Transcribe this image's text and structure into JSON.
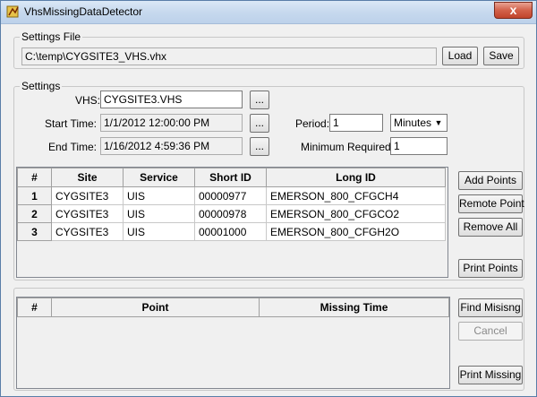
{
  "window": {
    "title": "VhsMissingDataDetector",
    "close_label": "x"
  },
  "settings_file": {
    "legend": "Settings File",
    "path": "C:\\temp\\CYGSITE3_VHS.vhx",
    "load_label": "Load",
    "save_label": "Save"
  },
  "settings": {
    "legend": "Settings",
    "vhs_label": "VHS:",
    "vhs_value": "CYGSITE3.VHS",
    "start_label": "Start Time:",
    "start_value": "1/1/2012 12:00:00 PM",
    "end_label": "End Time:",
    "end_value": "1/16/2012 4:59:36 PM",
    "browse_label": "...",
    "period_label": "Period:",
    "period_value": "1",
    "period_unit": "Minutes",
    "min_required_label": "Minimum Required:",
    "min_required_value": "1"
  },
  "points_grid": {
    "columns": [
      "#",
      "Site",
      "Service",
      "Short ID",
      "Long ID"
    ],
    "rows": [
      [
        "1",
        "CYGSITE3",
        "UIS",
        "00000977",
        "EMERSON_800_CFGCH4"
      ],
      [
        "2",
        "CYGSITE3",
        "UIS",
        "00000978",
        "EMERSON_800_CFGCO2"
      ],
      [
        "3",
        "CYGSITE3",
        "UIS",
        "00001000",
        "EMERSON_800_CFGH2O"
      ]
    ]
  },
  "points_buttons": {
    "add": "Add Points",
    "remote": "Remote Point",
    "remove_all": "Remove All",
    "print": "Print Points"
  },
  "missing_grid": {
    "columns": [
      "#",
      "Point",
      "Missing Time"
    ]
  },
  "missing_buttons": {
    "find": "Find Misisng",
    "cancel": "Cancel",
    "print": "Print Missing"
  }
}
